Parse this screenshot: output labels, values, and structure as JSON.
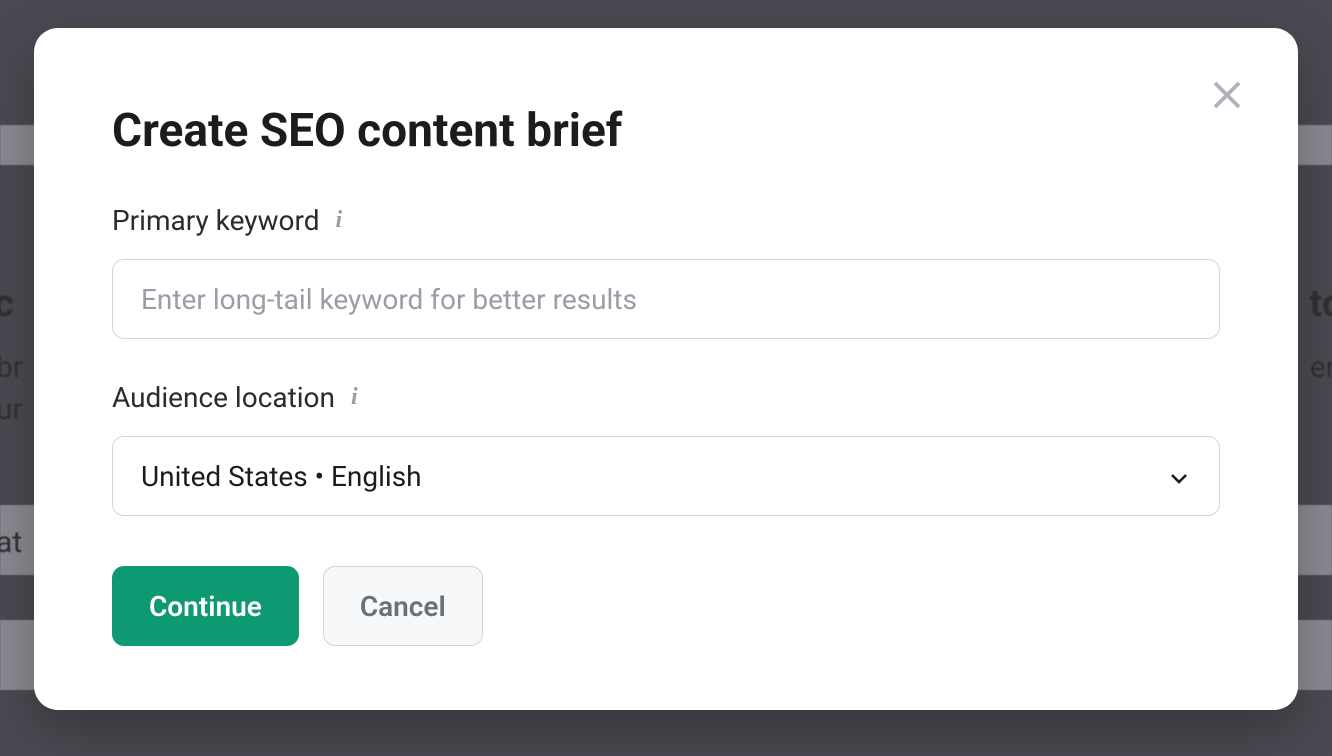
{
  "modal": {
    "title": "Create SEO content brief",
    "close_label": "Close",
    "fields": {
      "primary_keyword": {
        "label": "Primary keyword",
        "placeholder": "Enter long-tail keyword for better results",
        "value": ""
      },
      "audience_location": {
        "label": "Audience location",
        "selected": "United States • English"
      }
    },
    "buttons": {
      "continue": "Continue",
      "cancel": "Cancel"
    }
  },
  "background": {
    "frag_left1": "c",
    "frag_left2": "br",
    "frag_left3": "ur",
    "frag_left4": "at",
    "frag_right1": "tcl",
    "frag_right2": "ent"
  }
}
